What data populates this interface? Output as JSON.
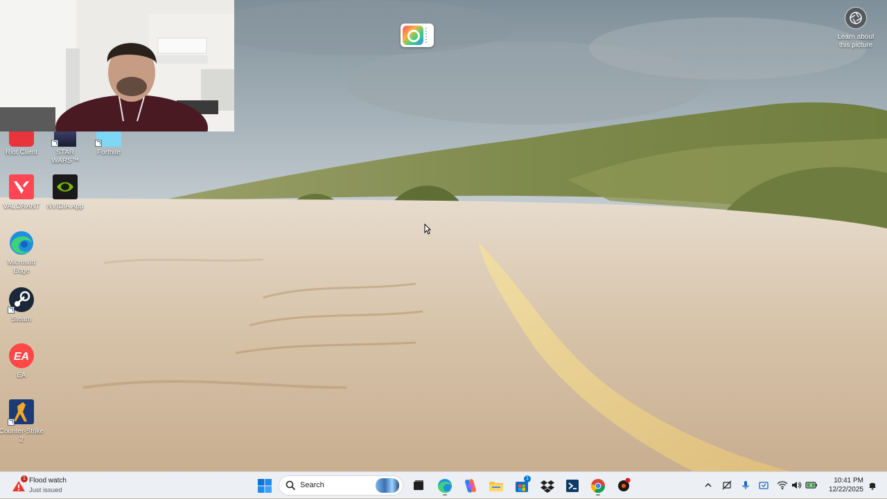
{
  "desktop": {
    "learn_label_line1": "Learn about",
    "learn_label_line2": "this picture",
    "icons": [
      {
        "label": "Riot Client",
        "icon": "riot-client-icon"
      },
      {
        "label": "STAR WARS™ Battlefront...",
        "icon": "star-wars-battlefront-icon"
      },
      {
        "label": "Fortnite",
        "icon": "fortnite-icon"
      },
      {
        "label": "VALORANT",
        "icon": "valorant-icon"
      },
      {
        "label": "NVIDIA App",
        "icon": "nvidia-app-icon"
      },
      {
        "label": "Microsoft Edge",
        "icon": "edge-icon"
      },
      {
        "label": "Steam",
        "icon": "steam-icon"
      },
      {
        "label": "EA",
        "icon": "ea-icon"
      },
      {
        "label": "Counter-Strike 2",
        "icon": "counter-strike-icon"
      }
    ]
  },
  "taskbar": {
    "weather_title": "Flood watch",
    "weather_sub": "Just issued",
    "weather_badge": "1",
    "search_placeholder": "Search",
    "store_badge": "1",
    "pinned": [
      "start",
      "search",
      "task-view",
      "edge",
      "copilot",
      "file-explorer",
      "microsoft-store",
      "dropbox",
      "visual-studio",
      "chrome",
      "steelseries"
    ],
    "tray": [
      "chevron-up",
      "network-off",
      "microphone",
      "tray-app",
      "wifi",
      "volume",
      "battery"
    ],
    "time": "10:41 PM",
    "date": "12/22/2025"
  },
  "colors": {
    "taskbar_bg": "#eceff3",
    "accent_blue": "#0078d4",
    "badge_red": "#c42b1c"
  }
}
